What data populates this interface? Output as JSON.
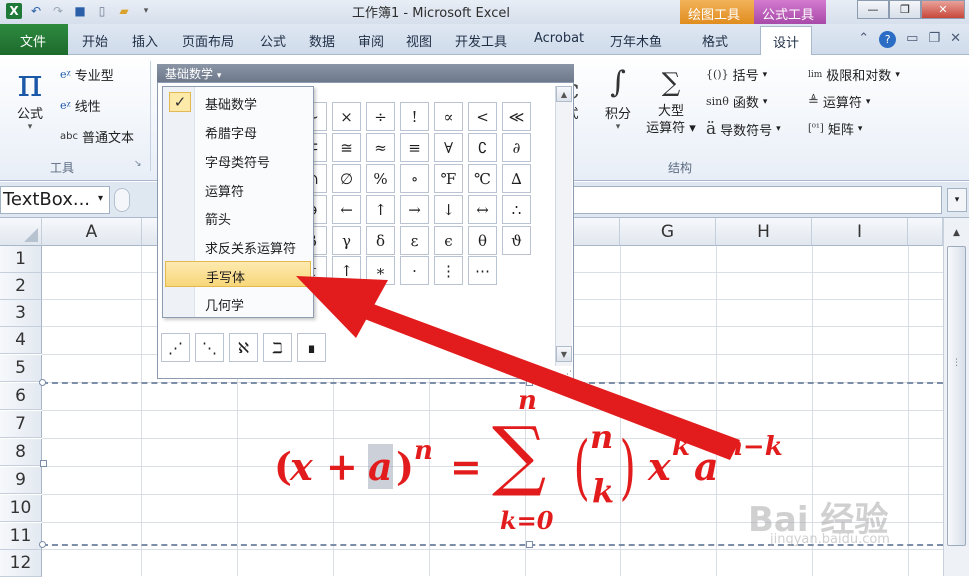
{
  "window": {
    "title": "工作簿1 - Microsoft Excel",
    "contextual_tabs": [
      "绘图工具",
      "公式工具"
    ]
  },
  "ribbon_tabs": {
    "file": "文件",
    "tabs": [
      "开始",
      "插入",
      "页面布局",
      "公式",
      "数据",
      "审阅",
      "视图",
      "开发工具",
      "Acrobat",
      "万年木鱼",
      "格式",
      "设计"
    ],
    "active": "设计"
  },
  "tools_group": {
    "equation_label": "公式",
    "professional": "专业型",
    "linear": "线性",
    "normal_text": "普通文本",
    "group_label": "工具"
  },
  "structures_group": {
    "fraction_label": "式",
    "integral": "积分",
    "large_operator": "大型\n运算符",
    "bracket": "括号",
    "function": "函数",
    "accent": "导数符号",
    "limit_log": "极限和对数",
    "operator": "运算符",
    "matrix": "矩阵",
    "group_label": "结构"
  },
  "gallery": {
    "header": "基础数学",
    "symbols": [
      [
        "~",
        "×",
        "÷",
        "!",
        "∝",
        "<",
        "≪"
      ],
      [
        "∓",
        "≅",
        "≈",
        "≡",
        "∀",
        "∁",
        "∂"
      ],
      [
        "∩",
        "∅",
        "%",
        "∘",
        "℉",
        "℃",
        "∆"
      ],
      [
        "∋",
        "←",
        "↑",
        "→",
        "↓",
        "↔",
        "∴"
      ],
      [
        "β",
        "γ",
        "δ",
        "ε",
        "ϵ",
        "θ",
        "ϑ"
      ],
      [
        "τ",
        "↑",
        "∗",
        "·",
        "⋮",
        "⋯"
      ],
      [
        "⋰",
        "⋱",
        "ℵ",
        "ℶ",
        "∎"
      ]
    ]
  },
  "symbol_menu": {
    "items": [
      "基础数学",
      "希腊字母",
      "字母类符号",
      "运算符",
      "箭头",
      "求反关系运算符",
      "手写体",
      "几何学"
    ],
    "checked": "基础数学",
    "highlighted": "手写体"
  },
  "formula_bar": {
    "name_box": "TextBox..."
  },
  "sheet": {
    "columns": [
      "A",
      "G",
      "H",
      "I"
    ],
    "rows": [
      "1",
      "2",
      "3",
      "4",
      "5",
      "6",
      "7",
      "8",
      "9",
      "10",
      "11",
      "12"
    ]
  },
  "equation": {
    "lparen": "(",
    "x": "x",
    "plus": "+",
    "a": "a",
    "rparen": ")",
    "exp_n": "n",
    "equals": "=",
    "sum_top": "n",
    "sum": "∑",
    "sum_bottom": "k=0",
    "binom_n": "n",
    "binom_k": "k",
    "xk_base": "x",
    "xk_exp": "k",
    "a_base": "a",
    "a_exp": "n−k"
  },
  "watermark": {
    "brand": "Bai 经验",
    "url": "jingyan.baidu.com"
  },
  "colors": {
    "equation": "#e21c1c",
    "arrow": "#e21c1c",
    "menu_highlight": "#f8d77a"
  }
}
